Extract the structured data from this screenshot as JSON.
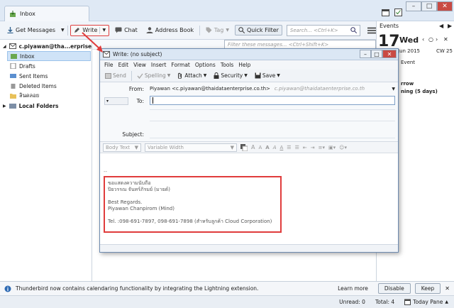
{
  "window": {
    "tab_title": "Inbox"
  },
  "toolbar": {
    "get_messages": "Get Messages",
    "write": "Write",
    "chat": "Chat",
    "address_book": "Address Book",
    "tag": "Tag",
    "quick_filter": "Quick Filter",
    "search_placeholder": "Search... <Ctrl+K>"
  },
  "list": {
    "filter_placeholder": "Filter these messages... <Ctrl+Shift+K>"
  },
  "folders": {
    "account": "c.piyawan@tha...erprise.co.th",
    "items": [
      "Inbox",
      "Drafts",
      "Sent Items",
      "Deleted Items",
      "ลินดลอย"
    ],
    "local": "Local Folders"
  },
  "events": {
    "header": "Events",
    "day_number": "17",
    "weekday": "Wed",
    "month_year": "Jun 2015",
    "week": "CW 25",
    "section": "Event",
    "item1": "rrow",
    "item2": "ning (5 days)"
  },
  "compose": {
    "title": "Write: (no subject)",
    "menu": [
      "File",
      "Edit",
      "View",
      "Insert",
      "Format",
      "Options",
      "Tools",
      "Help"
    ],
    "toolbar": {
      "send": "Send",
      "spelling": "Spelling",
      "attach": "Attach",
      "security": "Security",
      "save": "Save"
    },
    "from_label": "From:",
    "from_value": "Piyawan <c.piyawan@thaidataenterprise.co.th>",
    "from_alias": "c.piyawan@thaidataenterprise.co.th",
    "to_label": "To:",
    "subject_label": "Subject:",
    "format": {
      "paragraph": "Body Text",
      "font": "Variable Width"
    },
    "signature": {
      "line1": "ขอแสดงความนับถือ",
      "line2": "ปิยวรรณ จันทร์ภิรมย์ (มายด์)",
      "line3": "Best Regards.",
      "line4": "Piyawan Chanpirom (Mind)",
      "line5": "Tel. :098-691-7897, 098-691-7898 (สำหรับลูกค้า Cloud Corporation)"
    },
    "dashes": "--"
  },
  "notification": {
    "message": "Thunderbird now contains calendaring functionality by integrating the Lightning extension.",
    "learn_more": "Learn more",
    "disable": "Disable",
    "keep": "Keep"
  },
  "status": {
    "unread": "Unread: 0",
    "total": "Total: 4",
    "today_pane": "Today Pane"
  },
  "colors": {
    "accent_red": "#e03c3c",
    "selection": "#cfe3f7"
  }
}
